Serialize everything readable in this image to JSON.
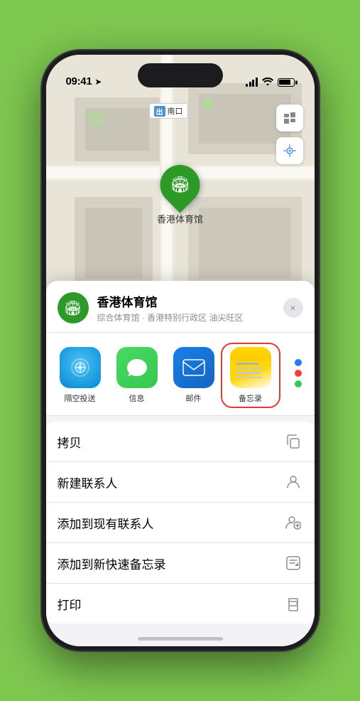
{
  "status_bar": {
    "time": "09:41",
    "location_arrow": "▶"
  },
  "map": {
    "label": "南口",
    "label_prefix": "出",
    "pin_name": "香港体育馆",
    "pin_emoji": "🏟"
  },
  "sheet": {
    "venue_name": "香港体育馆",
    "venue_subtitle": "综合体育馆 · 香港特别行政区 油尖旺区",
    "close_label": "×"
  },
  "apps": [
    {
      "id": "airdrop",
      "label": "隔空投送"
    },
    {
      "id": "messages",
      "label": "信息"
    },
    {
      "id": "mail",
      "label": "邮件"
    },
    {
      "id": "notes",
      "label": "备忘录"
    }
  ],
  "actions": [
    {
      "label": "拷贝",
      "icon": "copy"
    },
    {
      "label": "新建联系人",
      "icon": "person"
    },
    {
      "label": "添加到现有联系人",
      "icon": "person-add"
    },
    {
      "label": "添加到新快速备忘录",
      "icon": "note"
    },
    {
      "label": "打印",
      "icon": "print"
    }
  ]
}
